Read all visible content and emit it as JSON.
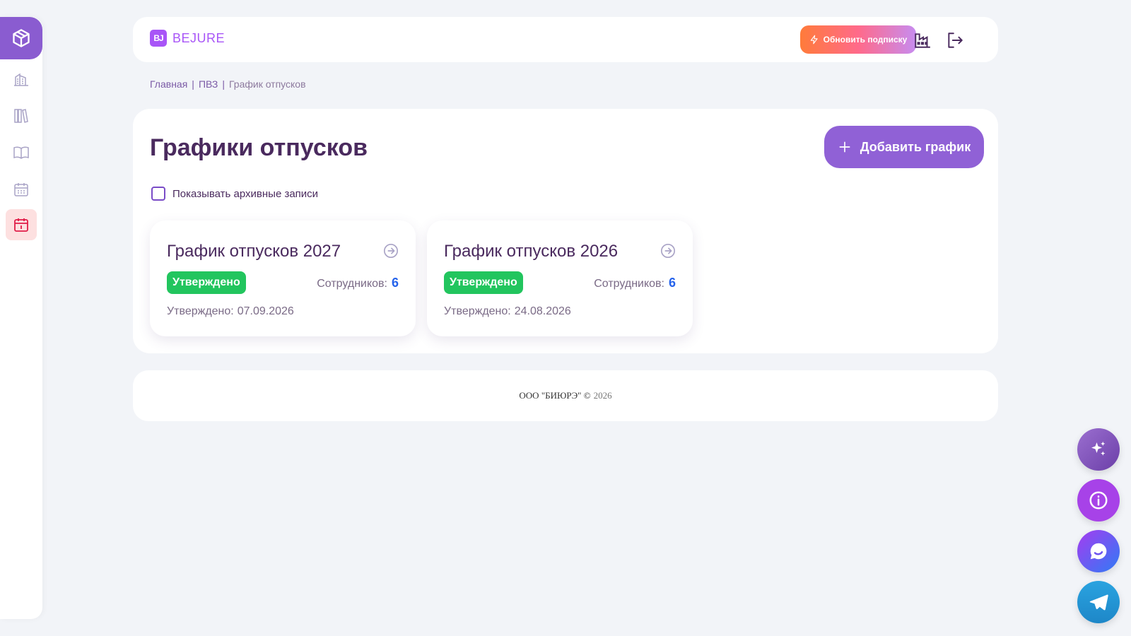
{
  "brand": {
    "mark": "BJ",
    "name": "BEJURE"
  },
  "header": {
    "upgrade_label": "Обновить подписку",
    "icons": [
      "factory-icon",
      "logout-icon"
    ]
  },
  "sidebar": {
    "items": [
      {
        "icon": "cube-icon"
      },
      {
        "icon": "building-icon"
      },
      {
        "icon": "library-icon"
      },
      {
        "icon": "book-icon"
      },
      {
        "icon": "calendar-grid-icon"
      },
      {
        "icon": "calendar-icon",
        "active": true
      }
    ]
  },
  "breadcrumb": {
    "items": [
      "Главная",
      "ПВЗ",
      "График отпусков"
    ],
    "separator": "|"
  },
  "main": {
    "title": "Графики отпусков",
    "add_button_label": "Добавить график",
    "archive_label": "Показывать архивные записи",
    "archive_checked": false,
    "cards": [
      {
        "title": "График отпусков 2027",
        "status": "Утверждено",
        "employees_label": "Сотрудников:",
        "employees_count": "6",
        "approved_label": "Утверждено:",
        "approved_date": "07.09.2026"
      },
      {
        "title": "График отпусков 2026",
        "status": "Утверждено",
        "employees_label": "Сотрудников:",
        "employees_count": "6",
        "approved_label": "Утверждено:",
        "approved_date": "24.08.2026"
      }
    ]
  },
  "footer": {
    "org": "ООО \"БИЮРЭ\" ©",
    "year": "2026"
  },
  "fabs": [
    "sparkle-icon",
    "info-icon",
    "chat-icon",
    "telegram-icon"
  ],
  "colors": {
    "accent": "#9061d6",
    "badge": "#22c55e",
    "employees_count": "#2563eb",
    "title": "#4a2a5e"
  }
}
